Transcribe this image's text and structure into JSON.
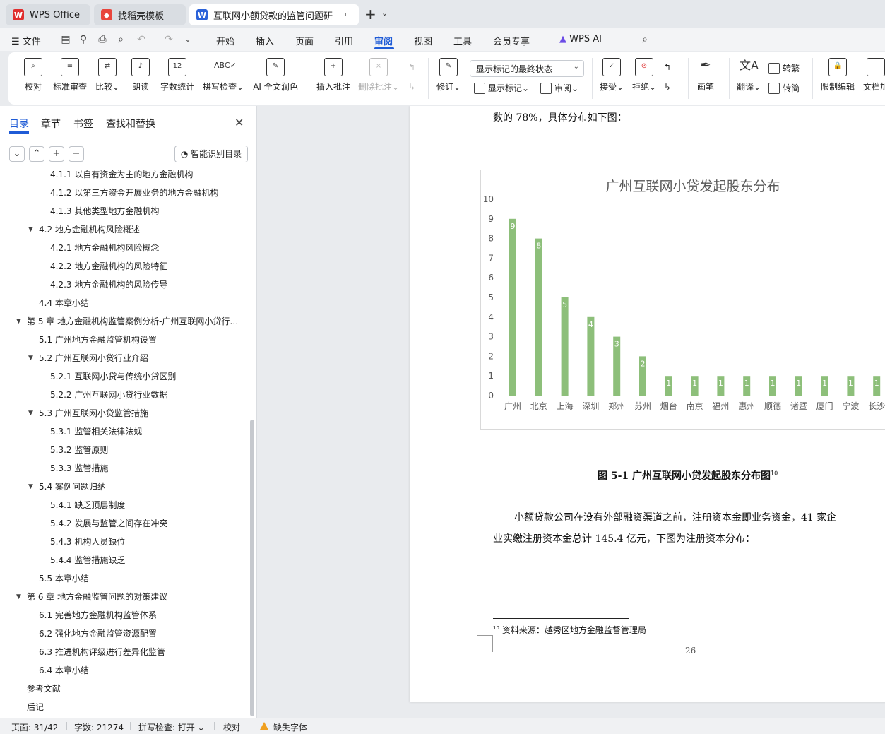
{
  "tabs": [
    {
      "label": "WPS Office",
      "icon": "wps-logo-icon"
    },
    {
      "label": "找稻壳模板",
      "icon": "docer-icon"
    },
    {
      "label": "互联网小额贷款的监管问题研究",
      "icon": "word-doc-icon",
      "active": true
    }
  ],
  "menubar": {
    "file": "文件",
    "items": [
      "开始",
      "插入",
      "页面",
      "引用",
      "审阅",
      "视图",
      "工具",
      "会员专享",
      "WPS AI"
    ],
    "active": "审阅"
  },
  "ribbon": {
    "proofread": "校对",
    "standard_review": "标准审查",
    "compare": "比较",
    "read_aloud": "朗读",
    "word_count": "字数统计",
    "spell_check": "拼写检查",
    "ai_polish": "AI 全文润色",
    "insert_comment": "插入批注",
    "delete_comment": "删除批注",
    "revise": "修订",
    "show_markup": "显示标记",
    "review": "审阅",
    "markup_select": "显示标记的最终状态",
    "accept": "接受",
    "reject": "拒绝",
    "pen": "画笔",
    "translate": "翻译",
    "to_traditional": "转繁",
    "to_simplified": "转简",
    "restrict_edit": "限制编辑",
    "doc_protect": "文档加"
  },
  "nav": {
    "tabs": [
      "目录",
      "章节",
      "书签",
      "查找和替换"
    ],
    "smart_toc": "智能识别目录",
    "toc": [
      {
        "label": "4.1.1  以自有资金为主的地方金融机构",
        "level": 3
      },
      {
        "label": "4.1.2  以第三方资金开展业务的地方金融机构",
        "level": 3
      },
      {
        "label": "4.1.3  其他类型地方金融机构",
        "level": 3
      },
      {
        "label": "4.2  地方金融机构风险概述",
        "level": 2,
        "expanded": true
      },
      {
        "label": "4.2.1  地方金融机构风险概念",
        "level": 3
      },
      {
        "label": "4.2.2  地方金融机构的风险特征",
        "level": 3
      },
      {
        "label": "4.2.3  地方金融机构的风险传导",
        "level": 3
      },
      {
        "label": "4.4  本章小结",
        "level": 2
      },
      {
        "label": "第 5 章  地方金融机构监管案例分析-广州互联网小贷行 ...",
        "level": 1,
        "expanded": true
      },
      {
        "label": "5.1  广州地方金融监管机构设置",
        "level": 2
      },
      {
        "label": "5.2  广州互联网小贷行业介绍",
        "level": 2,
        "expanded": true
      },
      {
        "label": "5.2.1  互联网小贷与传统小贷区别",
        "level": 3
      },
      {
        "label": "5.2.2  广州互联网小贷行业数据",
        "level": 3
      },
      {
        "label": "5.3  广州互联网小贷监管措施",
        "level": 2,
        "expanded": true
      },
      {
        "label": "5.3.1  监管相关法律法规",
        "level": 3
      },
      {
        "label": "5.3.2  监管原则",
        "level": 3
      },
      {
        "label": "5.3.3  监管措施",
        "level": 3
      },
      {
        "label": "5.4  案例问题归纳",
        "level": 2,
        "expanded": true
      },
      {
        "label": "5.4.1  缺乏顶层制度",
        "level": 3
      },
      {
        "label": "5.4.2  发展与监管之间存在冲突",
        "level": 3
      },
      {
        "label": "5.4.3  机构人员缺位",
        "level": 3
      },
      {
        "label": "5.4.4  监管措施缺乏",
        "level": 3
      },
      {
        "label": "5.5  本章小结",
        "level": 2
      },
      {
        "label": "第 6 章  地方金融监管问题的对策建议",
        "level": 1,
        "expanded": true
      },
      {
        "label": "6.1  完善地方金融机构监管体系",
        "level": 2
      },
      {
        "label": "6.2  强化地方金融监管资源配置",
        "level": 2
      },
      {
        "label": "6.3  推进机构评级进行差异化监管",
        "level": 2
      },
      {
        "label": "6.4  本章小结",
        "level": 2
      },
      {
        "label": "参考文献",
        "level": 1
      },
      {
        "label": "后记",
        "level": 1
      }
    ]
  },
  "document": {
    "line_top": "数的 78%，具体分布如下图：",
    "caption": "图 5-1   广州互联网小贷发起股东分布图",
    "caption_ref": "10",
    "para_line1": "小额贷款公司在没有外部融资渠道之前，注册资本金即业务资金，41 家企",
    "para_line2": "业实缴注册资本金总计 145.4 亿元，下图为注册资本分布：",
    "footnote_ref": "10",
    "footnote": "资料来源：越秀区地方金融监督管理局",
    "page_number": "26"
  },
  "chart_data": {
    "type": "bar",
    "title": "广州互联网小贷发起股东分布",
    "categories": [
      "广州",
      "北京",
      "上海",
      "深圳",
      "郑州",
      "苏州",
      "烟台",
      "南京",
      "福州",
      "惠州",
      "顺德",
      "诸暨",
      "厦门",
      "宁波",
      "长沙"
    ],
    "values": [
      9,
      8,
      5,
      4,
      3,
      2,
      1,
      1,
      1,
      1,
      1,
      1,
      1,
      1,
      1
    ],
    "ylim": [
      0,
      10
    ],
    "yticks": [
      0,
      1,
      2,
      3,
      4,
      5,
      6,
      7,
      8,
      9,
      10
    ],
    "data_labels": true,
    "grid": false,
    "bar_color": "#8dbf7a"
  },
  "status": {
    "page": "页面: 31/42",
    "words": "字数: 21274",
    "spell": "拼写检查: 打开",
    "proof": "校对",
    "missing_font": "缺失字体"
  },
  "colors": {
    "accent": "#1f5bd6",
    "warning": "#f0a020"
  }
}
